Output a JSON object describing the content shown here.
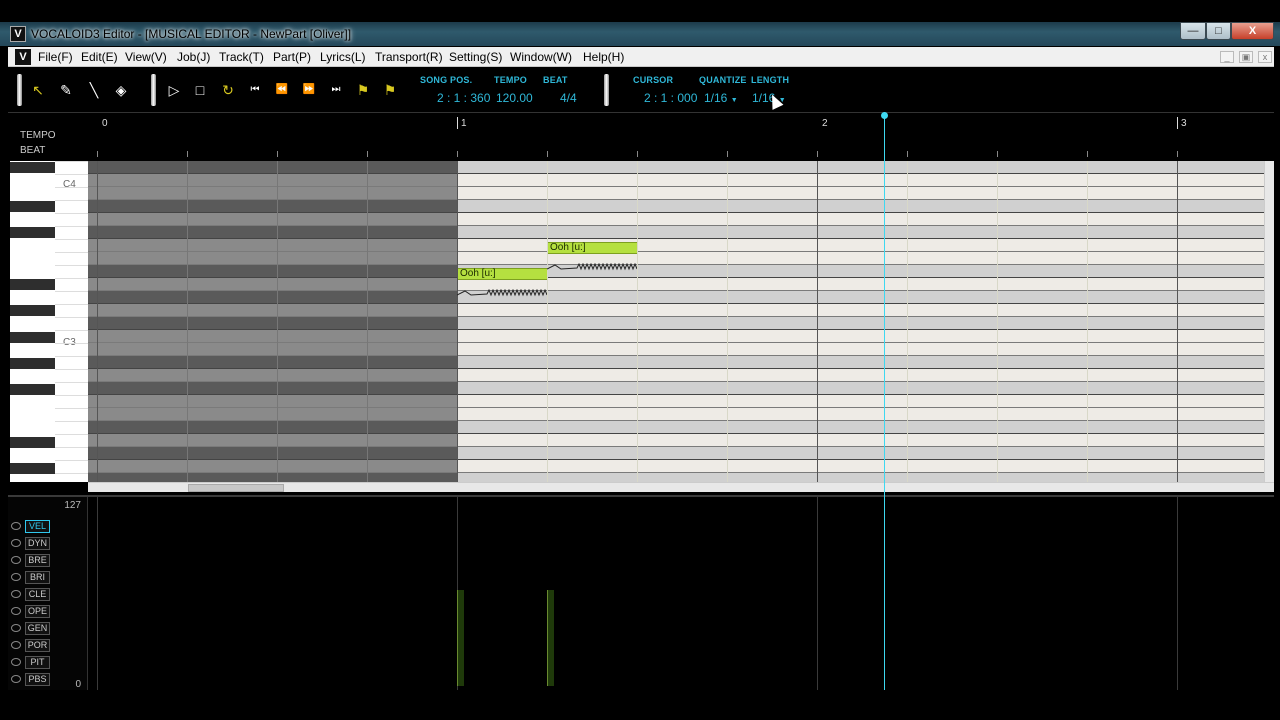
{
  "window": {
    "title": "VOCALOID3 Editor - [MUSICAL EDITOR - NewPart [Oliver]]",
    "icon_letter": "V",
    "min_label": "—",
    "max_label": "□",
    "close_label": "X"
  },
  "menu": {
    "icon_letter": "V",
    "items": [
      "File(F)",
      "Edit(E)",
      "View(V)",
      "Job(J)",
      "Track(T)",
      "Part(P)",
      "Lyrics(L)",
      "Transport(R)",
      "Setting(S)",
      "Window(W)",
      "Help(H)"
    ],
    "mdi_min": "_",
    "mdi_restore": "▣",
    "mdi_close": "x"
  },
  "toolbar": {
    "tools": [
      "arrow-tool-icon",
      "pencil-tool-icon",
      "line-tool-icon",
      "eraser-tool-icon"
    ],
    "transport": [
      "play-icon",
      "stop-icon",
      "loop-icon",
      "go-start-icon",
      "rewind-icon",
      "fast-forward-icon",
      "go-end-icon",
      "metronome-icon",
      "punch-icon"
    ],
    "song_pos_label": "SONG POS.",
    "song_pos_value": "2 : 1 : 360",
    "tempo_label": "TEMPO",
    "tempo_value": "120.00",
    "beat_label": "BEAT",
    "beat_value": "4/4",
    "cursor_label": "CURSOR",
    "cursor_value": "2 : 1 : 000",
    "quantize_label": "QUANTIZE",
    "quantize_value": "1/16",
    "length_label": "LENGTH",
    "length_value": "1/16"
  },
  "ruler": {
    "tempo_label": "TEMPO",
    "beat_label": "BEAT",
    "bars": [
      "0",
      "1",
      "2",
      "3"
    ]
  },
  "pianoroll": {
    "key_labels": [
      "C4",
      "C3"
    ],
    "notes": [
      {
        "lyric": "Ooh [u:]"
      },
      {
        "lyric": "Ooh [u:]"
      }
    ]
  },
  "control": {
    "max_value": "127",
    "min_value": "0",
    "params": [
      "VEL",
      "DYN",
      "BRE",
      "BRI",
      "CLE",
      "OPE",
      "GEN",
      "POR",
      "PIT",
      "PBS"
    ],
    "active_param": "VEL"
  },
  "colors": {
    "accent": "#2fb8d8",
    "note_fill": "#b5e040",
    "cursor": "#3ed8f0"
  }
}
